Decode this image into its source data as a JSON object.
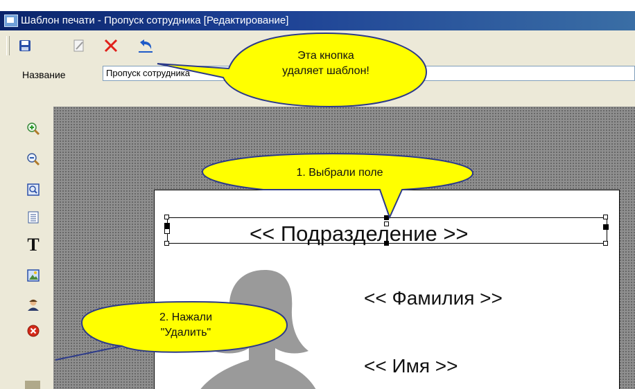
{
  "window": {
    "title": "Шаблон печати - Пропуск сотрудника [Редактирование]"
  },
  "toolbar": {
    "buttons": [
      {
        "icon": "save-icon",
        "color": "#2a4fa8"
      },
      {
        "icon": "edit-icon",
        "color": "#9a9a9a"
      },
      {
        "icon": "delete-icon",
        "color": "#e0201a"
      },
      {
        "icon": "undo-icon",
        "color": "#1e5bc8"
      }
    ]
  },
  "name_field": {
    "label": "Название",
    "value": "Пропуск сотрудника"
  },
  "sidebar": {
    "tools": [
      "zoom-in-icon",
      "zoom-out-icon",
      "fit-page-icon",
      "text-block-icon",
      "text-tool-icon",
      "image-icon",
      "photo-icon",
      "delete-field-icon"
    ],
    "text_tool_glyph": "T"
  },
  "template": {
    "fields": {
      "department": "<< Подразделение >>",
      "surname": "<< Фамилия >>",
      "name": "<< Имя >>"
    }
  },
  "callouts": {
    "delete_template": {
      "line1": "Эта кнопка",
      "line2": "удаляет шаблон!"
    },
    "selected_field": {
      "text": "1. Выбрали поле"
    },
    "pressed_delete": {
      "line1": "2. Нажали",
      "line2": "\"Удалить\""
    }
  },
  "colors": {
    "callout_fill": "#ffff00",
    "callout_border": "#2c3a8a",
    "title_bar": "#0a246a"
  }
}
